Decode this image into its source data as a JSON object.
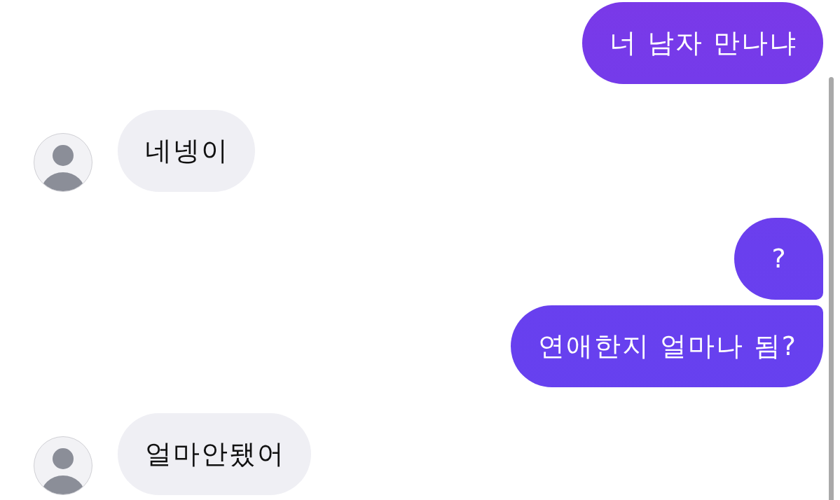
{
  "messages": [
    {
      "kind": "sent",
      "text": "너 남자 만나냐"
    },
    {
      "kind": "received",
      "text": "네넹이"
    },
    {
      "kind": "sent",
      "text": "?"
    },
    {
      "kind": "sent",
      "text": "연애한지 얼마나 됨?"
    },
    {
      "kind": "received",
      "text": "얼마안됐어"
    }
  ]
}
